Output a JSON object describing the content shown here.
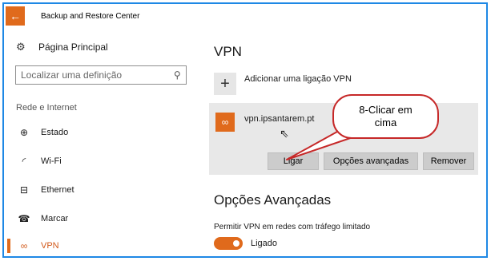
{
  "window": {
    "title": "Backup and Restore Center",
    "back_symbol": "←"
  },
  "sidebar": {
    "home_label": "Página Principal",
    "search_placeholder": "Localizar uma definição",
    "section_label": "Rede e Internet",
    "items": [
      {
        "label": "Estado",
        "icon": "globe-icon",
        "active": false
      },
      {
        "label": "Wi-Fi",
        "icon": "wifi-icon",
        "active": false
      },
      {
        "label": "Ethernet",
        "icon": "ethernet-icon",
        "active": false
      },
      {
        "label": "Marcar",
        "icon": "dialup-icon",
        "active": false
      },
      {
        "label": "VPN",
        "icon": "vpn-icon",
        "active": true
      }
    ]
  },
  "main": {
    "title": "VPN",
    "add_label": "Adicionar uma ligação VPN",
    "connection": {
      "name": "vpn.ipsantarem.pt",
      "connect_label": "Ligar",
      "advanced_label": "Opções avançadas",
      "remove_label": "Remover"
    },
    "advanced_title": "Opções Avançadas",
    "metered_label": "Permitir VPN em redes com tráfego limitado",
    "toggle_state": "Ligado"
  },
  "callout": {
    "line1": "8-Clicar em",
    "line2": "cima"
  },
  "colors": {
    "accent": "#e06a1c",
    "frame_border": "#1e88e5",
    "callout_border": "#c62828"
  }
}
